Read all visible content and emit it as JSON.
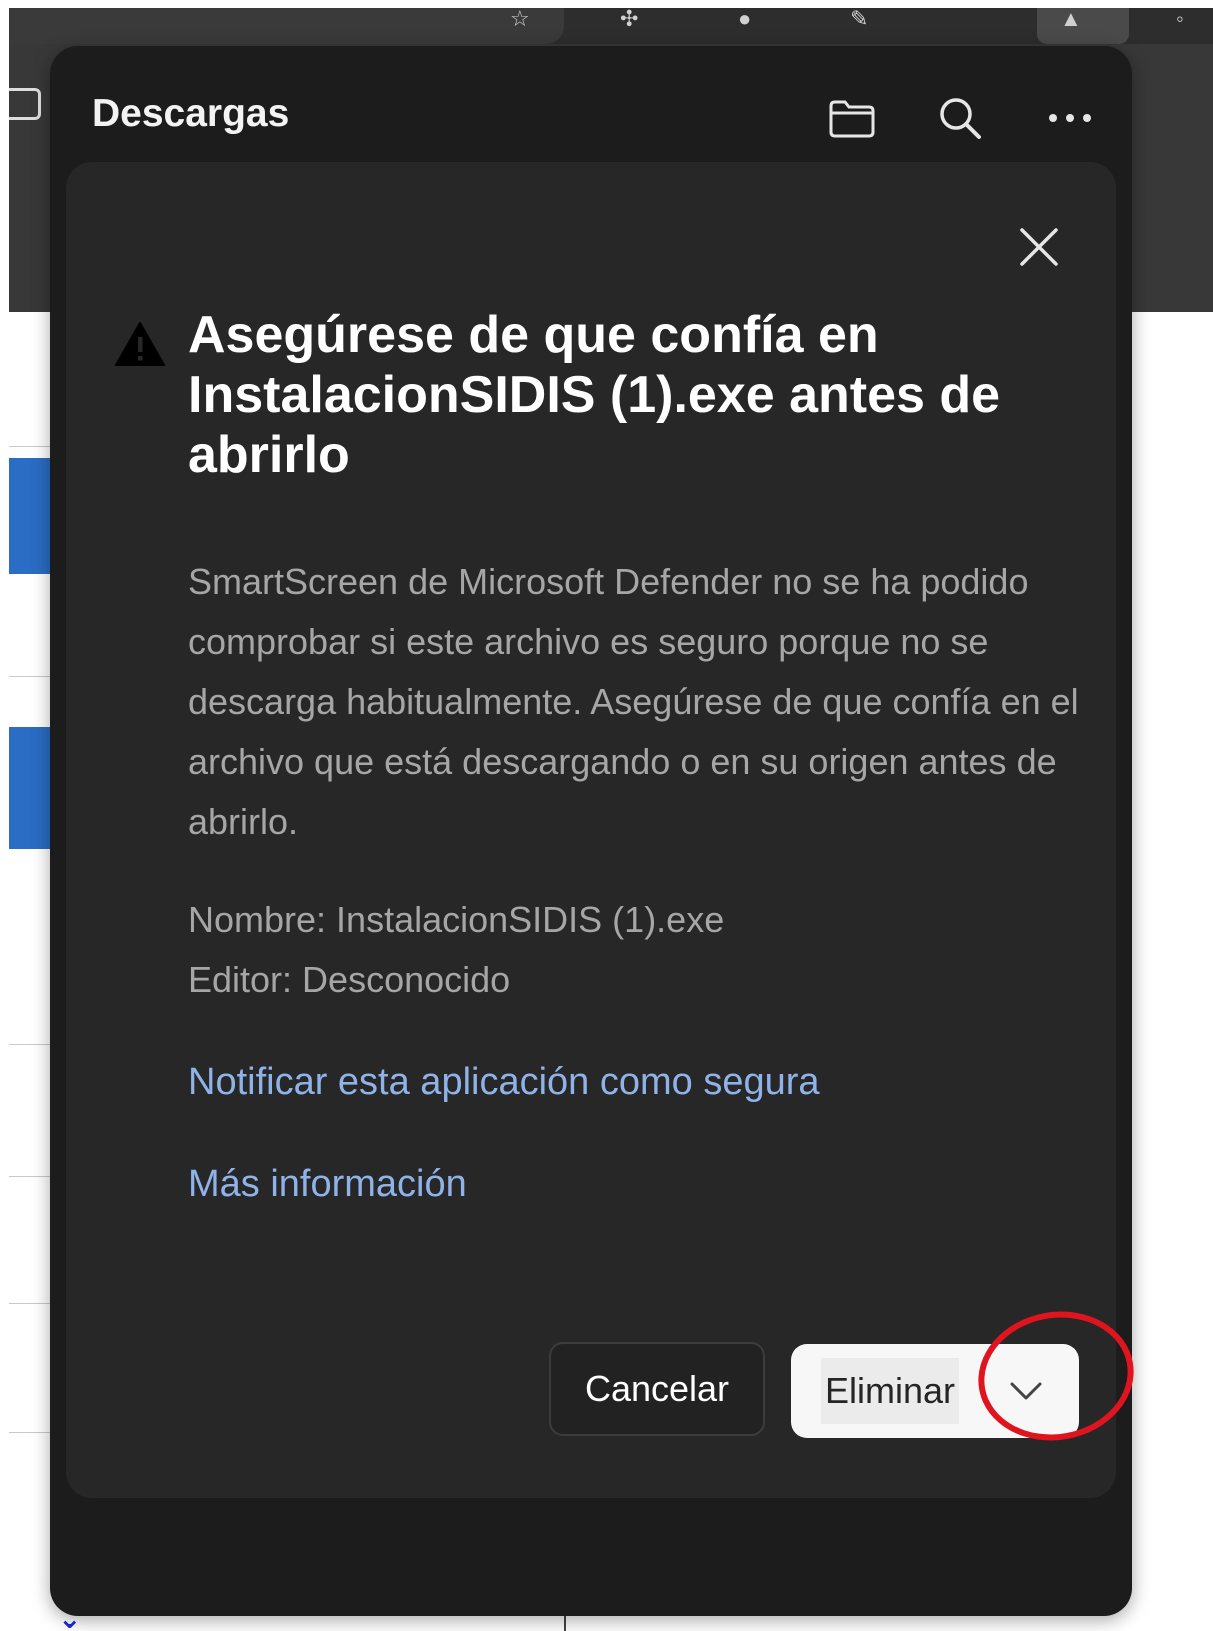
{
  "panel": {
    "title": "Descargas",
    "actions": [
      {
        "name": "open-folder",
        "icon": "folder-icon"
      },
      {
        "name": "search",
        "icon": "search-icon"
      },
      {
        "name": "more-options",
        "icon": "more-icon"
      }
    ]
  },
  "warning_card": {
    "heading": "Asegúrese de que confía en InstalacionSIDIS (1).exe antes de abrirlo",
    "body": "SmartScreen de Microsoft Defender no se ha podido comprobar si este archivo es seguro porque no se descarga habitualmente. Asegúrese de que confía en el archivo que está descargando o en su origen antes de abrirlo.",
    "name_line": "Nombre: InstalacionSIDIS (1).exe",
    "publisher_line": "Editor: Desconocido",
    "report_safe_link": "Notificar esta aplicación como segura",
    "more_info_link": "Más información",
    "cancel_label": "Cancelar",
    "delete_label": "Eliminar"
  },
  "colors": {
    "panel_bg": "#1c1c1c",
    "card_bg": "#272727",
    "link": "#8fb3e8",
    "annotation": "#e0141e"
  }
}
